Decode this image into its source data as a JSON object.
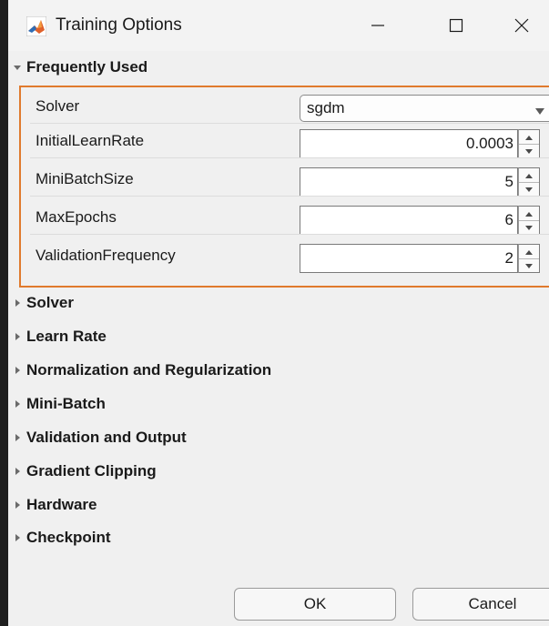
{
  "window": {
    "title": "Training Options",
    "app_icon": "matlab-icon",
    "controls": {
      "minimize_icon": "minimize-icon",
      "maximize_icon": "maximize-icon",
      "close_icon": "close-icon"
    }
  },
  "frequently_used": {
    "label": "Frequently Used",
    "expanded": true,
    "fields": [
      {
        "label": "Solver",
        "type": "select",
        "value": "sgdm"
      },
      {
        "label": "InitialLearnRate",
        "type": "spinner",
        "value": "0.0003"
      },
      {
        "label": "MiniBatchSize",
        "type": "spinner",
        "value": "5"
      },
      {
        "label": "MaxEpochs",
        "type": "spinner",
        "value": "6"
      },
      {
        "label": "ValidationFrequency",
        "type": "spinner",
        "value": "2"
      }
    ]
  },
  "sections": [
    {
      "label": "Solver",
      "expanded": false
    },
    {
      "label": "Learn Rate",
      "expanded": false
    },
    {
      "label": "Normalization and Regularization",
      "expanded": false
    },
    {
      "label": "Mini-Batch",
      "expanded": false
    },
    {
      "label": "Validation and Output",
      "expanded": false
    },
    {
      "label": "Gradient Clipping",
      "expanded": false
    },
    {
      "label": "Hardware",
      "expanded": false
    },
    {
      "label": "Checkpoint",
      "expanded": false
    }
  ],
  "buttons": {
    "ok": "OK",
    "cancel": "Cancel"
  },
  "colors": {
    "group_border": "#e07a2d",
    "background": "#f0f0f0"
  }
}
